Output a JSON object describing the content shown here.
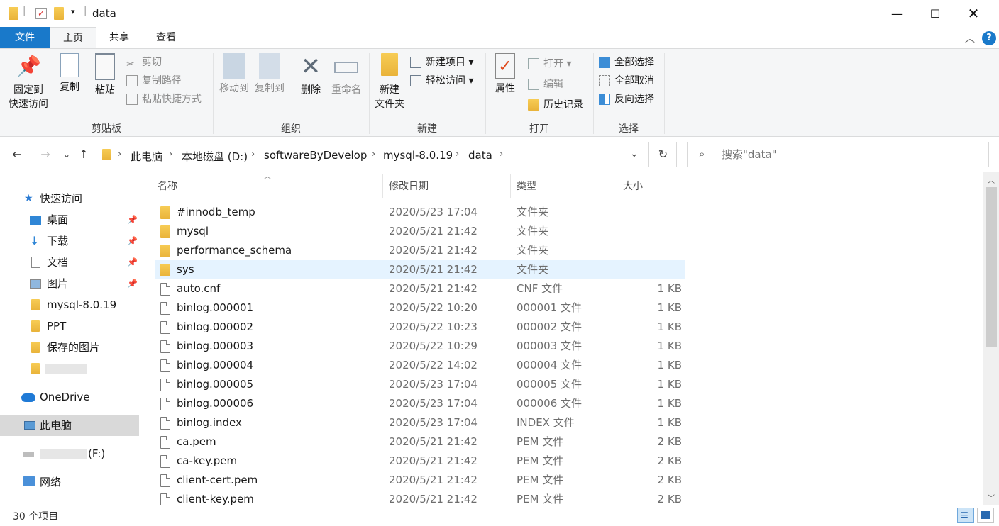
{
  "window": {
    "title": "data"
  },
  "ribbon_tabs": [
    "文件",
    "主页",
    "共享",
    "查看"
  ],
  "ribbon": {
    "clipboard": {
      "label": "剪贴板",
      "pin": "固定到\n快速访问",
      "copy": "复制",
      "paste": "粘贴",
      "cut": "剪切",
      "copy_path": "复制路径",
      "paste_shortcut": "粘贴快捷方式"
    },
    "organize": {
      "label": "组织",
      "move_to": "移动到",
      "copy_to": "复制到",
      "delete": "删除",
      "rename": "重命名"
    },
    "new": {
      "label": "新建",
      "new_folder": "新建\n文件夹",
      "new_item": "新建项目",
      "easy_access": "轻松访问"
    },
    "open": {
      "label": "打开",
      "properties": "属性",
      "open": "打开",
      "edit": "编辑",
      "history": "历史记录"
    },
    "select": {
      "label": "选择",
      "select_all": "全部选择",
      "select_none": "全部取消",
      "invert": "反向选择"
    }
  },
  "address": {
    "crumbs": [
      "此电脑",
      "本地磁盘 (D:)",
      "softwareByDevelop",
      "mysql-8.0.19",
      "data"
    ],
    "search_placeholder": "搜索\"data\""
  },
  "nav": {
    "quick_access": "快速访问",
    "items": [
      "桌面",
      "下载",
      "文档",
      "图片",
      "mysql-8.0.19",
      "PPT",
      "保存的图片"
    ],
    "onedrive": "OneDrive",
    "this_pc": "此电脑",
    "drive_f": "(F:)",
    "network": "网络"
  },
  "columns": {
    "name": "名称",
    "date": "修改日期",
    "type": "类型",
    "size": "大小"
  },
  "files": [
    {
      "name": "#innodb_temp",
      "date": "2020/5/23 17:04",
      "type": "文件夹",
      "size": "",
      "folder": true
    },
    {
      "name": "mysql",
      "date": "2020/5/21 21:42",
      "type": "文件夹",
      "size": "",
      "folder": true
    },
    {
      "name": "performance_schema",
      "date": "2020/5/21 21:42",
      "type": "文件夹",
      "size": "",
      "folder": true
    },
    {
      "name": "sys",
      "date": "2020/5/21 21:42",
      "type": "文件夹",
      "size": "",
      "folder": true,
      "selected": true
    },
    {
      "name": "auto.cnf",
      "date": "2020/5/21 21:42",
      "type": "CNF 文件",
      "size": "1 KB"
    },
    {
      "name": "binlog.000001",
      "date": "2020/5/22 10:20",
      "type": "000001 文件",
      "size": "1 KB"
    },
    {
      "name": "binlog.000002",
      "date": "2020/5/22 10:23",
      "type": "000002 文件",
      "size": "1 KB"
    },
    {
      "name": "binlog.000003",
      "date": "2020/5/22 10:29",
      "type": "000003 文件",
      "size": "1 KB"
    },
    {
      "name": "binlog.000004",
      "date": "2020/5/22 14:02",
      "type": "000004 文件",
      "size": "1 KB"
    },
    {
      "name": "binlog.000005",
      "date": "2020/5/23 17:04",
      "type": "000005 文件",
      "size": "1 KB"
    },
    {
      "name": "binlog.000006",
      "date": "2020/5/23 17:04",
      "type": "000006 文件",
      "size": "1 KB"
    },
    {
      "name": "binlog.index",
      "date": "2020/5/23 17:04",
      "type": "INDEX 文件",
      "size": "1 KB"
    },
    {
      "name": "ca.pem",
      "date": "2020/5/21 21:42",
      "type": "PEM 文件",
      "size": "2 KB"
    },
    {
      "name": "ca-key.pem",
      "date": "2020/5/21 21:42",
      "type": "PEM 文件",
      "size": "2 KB"
    },
    {
      "name": "client-cert.pem",
      "date": "2020/5/21 21:42",
      "type": "PEM 文件",
      "size": "2 KB"
    },
    {
      "name": "client-key.pem",
      "date": "2020/5/21 21:42",
      "type": "PEM 文件",
      "size": "2 KB"
    }
  ],
  "status": {
    "count": "30 个项目"
  },
  "colors": {
    "accent": "#1979ca",
    "selection": "#e5f3ff",
    "folder": "#f2c14e"
  }
}
